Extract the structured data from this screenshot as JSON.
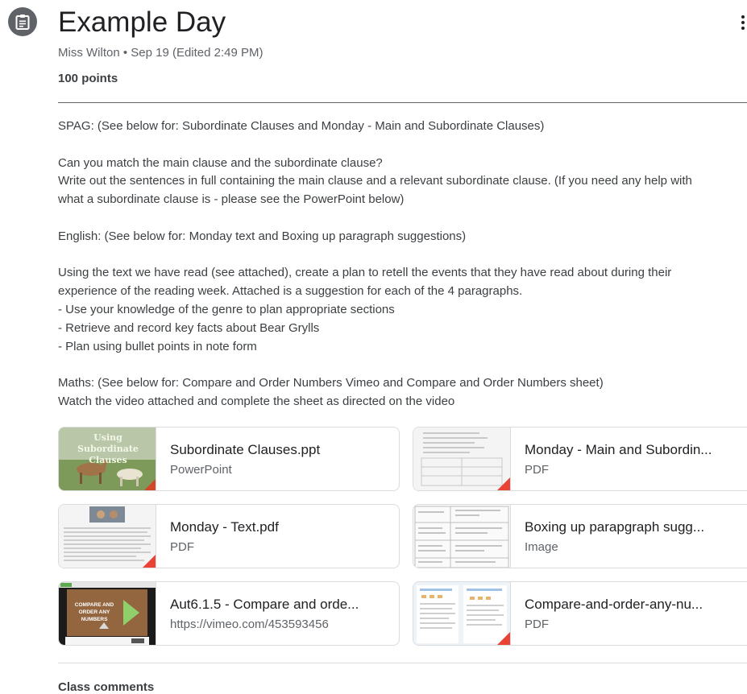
{
  "assignment": {
    "title": "Example Day",
    "meta": "Miss Wilton • Sep 19 (Edited 2:49 PM)",
    "points": "100 points"
  },
  "description": [
    "SPAG: (See below for: Subordinate Clauses and Monday - Main and Subordinate Clauses)",
    "",
    "Can you match the main clause and the subordinate clause?",
    "Write out the sentences in full containing the main clause and a relevant subordinate clause. (If you need any help with",
    "what a subordinate clause is - please see the PowerPoint below)",
    "",
    "English: (See below for: Monday text and Boxing up paragraph suggestions)",
    "",
    "Using the text we have read (see attached), create a plan to retell the events that they have read about during their",
    "experience of the reading week. Attached is a suggestion for each of the 4 paragraphs.",
    "- Use your knowledge of the genre to plan appropriate sections",
    "- Retrieve and record key facts about Bear Grylls",
    "- Plan using bullet points in note form",
    "",
    "Maths: (See below for: Compare and Order Numbers Vimeo and Compare and Order Numbers sheet)",
    "Watch the video attached and complete the sheet as directed on the video"
  ],
  "attachments": [
    {
      "title": "Subordinate Clauses.ppt",
      "type": "PowerPoint",
      "thumb_text": "Using Subordinate Clauses",
      "icon": "powerpoint-icon"
    },
    {
      "title": "Monday - Main and Subordin...",
      "type": "PDF",
      "icon": "pdf-icon"
    },
    {
      "title": "Monday - Text.pdf",
      "type": "PDF",
      "icon": "pdf-icon"
    },
    {
      "title": "Boxing up parapgraph sugg...",
      "type": "Image",
      "icon": "image-icon"
    },
    {
      "title": "Aut6.1.5 - Compare and orde...",
      "type": "https://vimeo.com/453593456",
      "thumb_text": "COMPARE AND ORDER ANY NUMBERS",
      "icon": "video-icon"
    },
    {
      "title": "Compare-and-order-any-nu...",
      "type": "PDF",
      "icon": "pdf-icon"
    }
  ],
  "comments": {
    "label": "Class comments"
  },
  "colors": {
    "pdf_corner": "#ea4335",
    "ppt_corner": "#d24726",
    "icon_bg": "#5f6368"
  }
}
